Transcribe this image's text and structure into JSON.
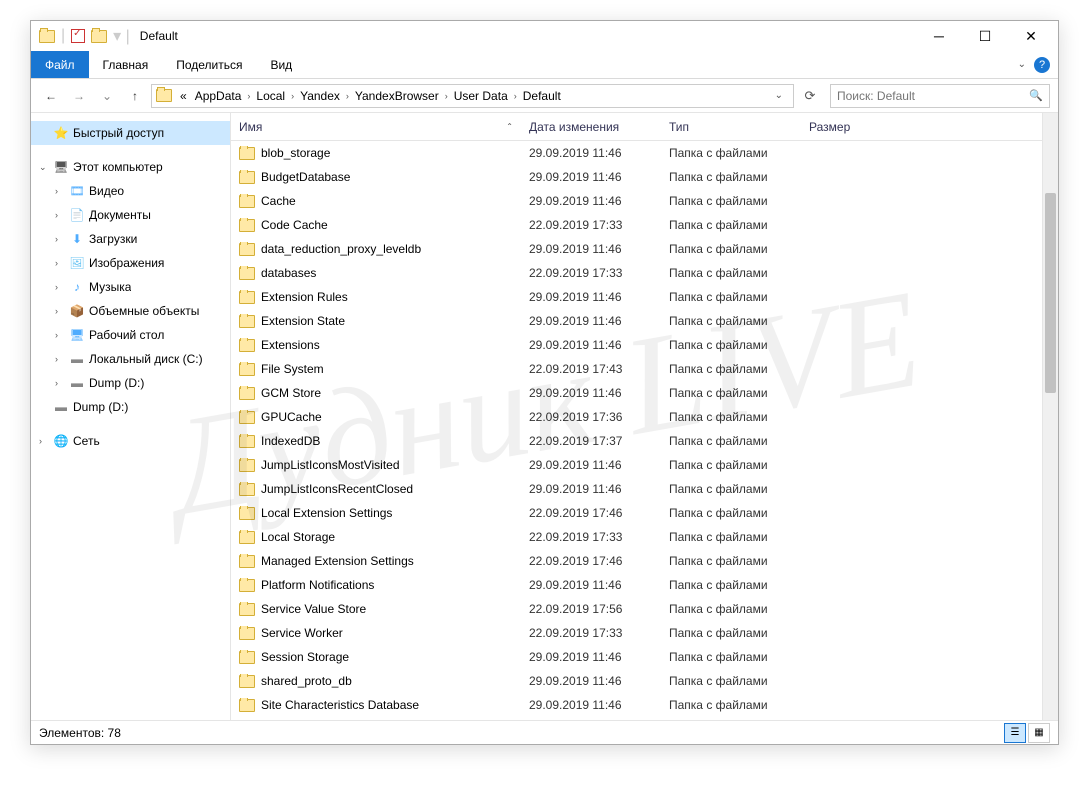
{
  "window_title": "Default",
  "ribbon": {
    "file": "Файл",
    "tabs": [
      "Главная",
      "Поделиться",
      "Вид"
    ]
  },
  "breadcrumb": {
    "prefix": "«",
    "items": [
      "AppData",
      "Local",
      "Yandex",
      "YandexBrowser",
      "User Data",
      "Default"
    ]
  },
  "search": {
    "placeholder": "Поиск: Default"
  },
  "sidebar": [
    {
      "exp": "",
      "icon": "⭐",
      "label": "Быстрый доступ",
      "indent": 0,
      "selected": true,
      "color": "#4fc3f7"
    },
    {
      "exp": "⌄",
      "icon": "🖥",
      "label": "Этот компьютер",
      "indent": 0,
      "color": "#555"
    },
    {
      "exp": "›",
      "icon": "🎞",
      "label": "Видео",
      "indent": 1,
      "color": "#4facfe"
    },
    {
      "exp": "›",
      "icon": "📄",
      "label": "Документы",
      "indent": 1,
      "color": "#7baaf7"
    },
    {
      "exp": "›",
      "icon": "⬇",
      "label": "Загрузки",
      "indent": 1,
      "color": "#4facfe"
    },
    {
      "exp": "›",
      "icon": "🖼",
      "label": "Изображения",
      "indent": 1,
      "color": "#6ec6f3"
    },
    {
      "exp": "›",
      "icon": "♪",
      "label": "Музыка",
      "indent": 1,
      "color": "#4facfe"
    },
    {
      "exp": "›",
      "icon": "📦",
      "label": "Объемные объекты",
      "indent": 1,
      "color": "#5eb5d6"
    },
    {
      "exp": "›",
      "icon": "🖥",
      "label": "Рабочий стол",
      "indent": 1,
      "color": "#4facfe"
    },
    {
      "exp": "›",
      "icon": "▬",
      "label": "Локальный диск (C:)",
      "indent": 1,
      "color": "#888"
    },
    {
      "exp": "›",
      "icon": "▬",
      "label": "Dump (D:)",
      "indent": 1,
      "color": "#888"
    },
    {
      "exp": "",
      "icon": "▬",
      "label": "Dump (D:)",
      "indent": 0,
      "color": "#888"
    },
    {
      "exp": "›",
      "icon": "🌐",
      "label": "Сеть",
      "indent": 0,
      "color": "#4facfe"
    }
  ],
  "columns": {
    "name": "Имя",
    "date": "Дата изменения",
    "type": "Тип",
    "size": "Размер"
  },
  "files": [
    {
      "name": "blob_storage",
      "date": "29.09.2019 11:46",
      "type": "Папка с файлами"
    },
    {
      "name": "BudgetDatabase",
      "date": "29.09.2019 11:46",
      "type": "Папка с файлами"
    },
    {
      "name": "Cache",
      "date": "29.09.2019 11:46",
      "type": "Папка с файлами"
    },
    {
      "name": "Code Cache",
      "date": "22.09.2019 17:33",
      "type": "Папка с файлами"
    },
    {
      "name": "data_reduction_proxy_leveldb",
      "date": "29.09.2019 11:46",
      "type": "Папка с файлами"
    },
    {
      "name": "databases",
      "date": "22.09.2019 17:33",
      "type": "Папка с файлами"
    },
    {
      "name": "Extension Rules",
      "date": "29.09.2019 11:46",
      "type": "Папка с файлами"
    },
    {
      "name": "Extension State",
      "date": "29.09.2019 11:46",
      "type": "Папка с файлами"
    },
    {
      "name": "Extensions",
      "date": "29.09.2019 11:46",
      "type": "Папка с файлами"
    },
    {
      "name": "File System",
      "date": "22.09.2019 17:43",
      "type": "Папка с файлами"
    },
    {
      "name": "GCM Store",
      "date": "29.09.2019 11:46",
      "type": "Папка с файлами"
    },
    {
      "name": "GPUCache",
      "date": "22.09.2019 17:36",
      "type": "Папка с файлами"
    },
    {
      "name": "IndexedDB",
      "date": "22.09.2019 17:37",
      "type": "Папка с файлами"
    },
    {
      "name": "JumpListIconsMostVisited",
      "date": "29.09.2019 11:46",
      "type": "Папка с файлами"
    },
    {
      "name": "JumpListIconsRecentClosed",
      "date": "29.09.2019 11:46",
      "type": "Папка с файлами"
    },
    {
      "name": "Local Extension Settings",
      "date": "22.09.2019 17:46",
      "type": "Папка с файлами"
    },
    {
      "name": "Local Storage",
      "date": "22.09.2019 17:33",
      "type": "Папка с файлами"
    },
    {
      "name": "Managed Extension Settings",
      "date": "22.09.2019 17:46",
      "type": "Папка с файлами"
    },
    {
      "name": "Platform Notifications",
      "date": "29.09.2019 11:46",
      "type": "Папка с файлами"
    },
    {
      "name": "Service Value Store",
      "date": "22.09.2019 17:56",
      "type": "Папка с файлами"
    },
    {
      "name": "Service Worker",
      "date": "22.09.2019 17:33",
      "type": "Папка с файлами"
    },
    {
      "name": "Session Storage",
      "date": "29.09.2019 11:46",
      "type": "Папка с файлами"
    },
    {
      "name": "shared_proto_db",
      "date": "29.09.2019 11:46",
      "type": "Папка с файлами"
    },
    {
      "name": "Site Characteristics Database",
      "date": "29.09.2019 11:46",
      "type": "Папка с файлами"
    }
  ],
  "status": {
    "items": "Элементов: 78"
  },
  "watermark": "Дудник LIVE"
}
